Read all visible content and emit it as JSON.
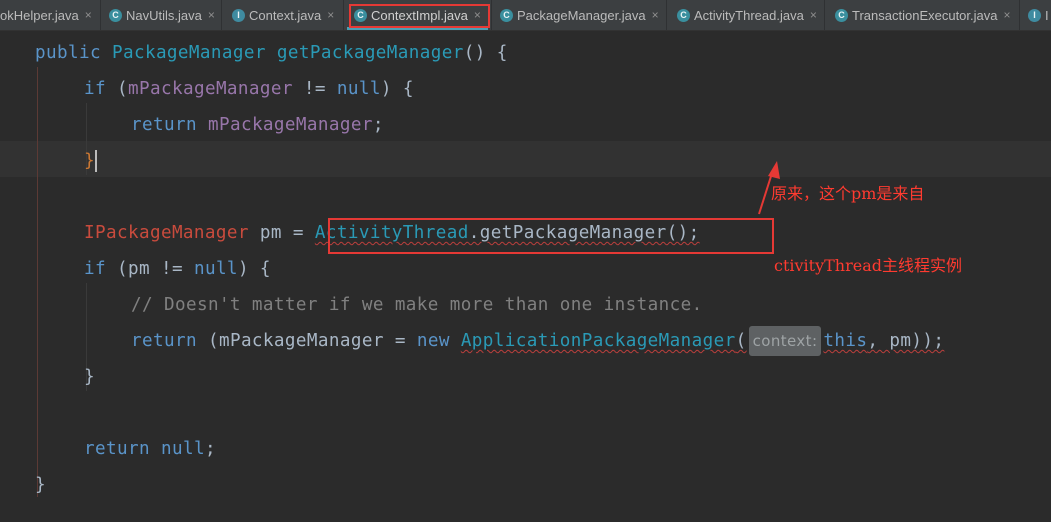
{
  "tabs": [
    {
      "label": "okHelper.java",
      "icon": "hook-class-icon"
    },
    {
      "label": "NavUtils.java",
      "icon": "class-icon"
    },
    {
      "label": "Context.java",
      "icon": "interface-icon"
    },
    {
      "label": "ContextImpl.java",
      "icon": "class-icon",
      "active": true
    },
    {
      "label": "PackageManager.java",
      "icon": "class-icon"
    },
    {
      "label": "ActivityThread.java",
      "icon": "class-icon"
    },
    {
      "label": "TransactionExecutor.java",
      "icon": "class-icon"
    },
    {
      "label": "I",
      "icon": "interface-icon"
    }
  ],
  "tab_close": "×",
  "code": {
    "l1_kw": "public",
    "l1_type": "PackageManager",
    "l1_fn": "getPackageManager",
    "l1_rest": "() {",
    "l2_kw": "if",
    "l2_field": "mPackageManager",
    "l2_rest": " != ",
    "l2_null": "null",
    "l2_brace": ") {",
    "l3_kw": "return",
    "l3_field": "mPackageManager",
    "l3_semi": ";",
    "l4_brace": "}",
    "l6_type": "IPackageManager",
    "l6_var": " pm = ",
    "l6_class": "ActivityThread",
    "l6_call": ".getPackageManager();",
    "l7_kw": "if",
    "l7_rest": " (pm != ",
    "l7_null": "null",
    "l7_brace": ") {",
    "l8_comment": "// Doesn't matter if we make more than one instance.",
    "l9_kw": "return",
    "l9_a": " (mPackageManager = ",
    "l9_new": "new",
    "l9_class": "ApplicationPackageManager",
    "l9_paren": "(",
    "l9_hint": "context:",
    "l9_this": "this",
    "l9_end": ", pm));",
    "l10_brace": "}",
    "l12_kw": "return",
    "l12_null": "null",
    "l12_semi": ";",
    "l13_brace": "}"
  },
  "annotation": {
    "line1": "原来，这个pm是来自",
    "line2": "ctivityThread主线程实例"
  },
  "colors": {
    "highlight": "#e53935",
    "annotation": "#ff3b30"
  }
}
